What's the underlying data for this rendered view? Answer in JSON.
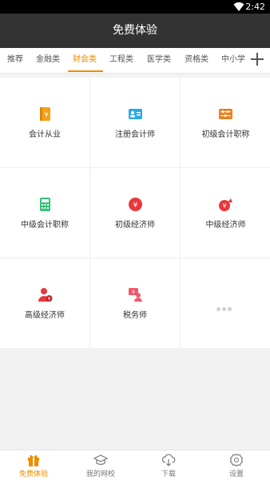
{
  "status_bar": {
    "time": "2:42"
  },
  "app_bar": {
    "title": "免费体验"
  },
  "tabs": {
    "items": [
      {
        "label": "推荐"
      },
      {
        "label": "金融类"
      },
      {
        "label": "财会类",
        "active": true
      },
      {
        "label": "工程类"
      },
      {
        "label": "医学类"
      },
      {
        "label": "资格类"
      },
      {
        "label": "中小学"
      }
    ],
    "add_icon": "plus-icon"
  },
  "grid": {
    "items": [
      {
        "label": "会计从业",
        "icon": "accounting-book-icon",
        "color": "#f5a01a"
      },
      {
        "label": "注册会计师",
        "icon": "id-card-icon",
        "color": "#2aa7f0"
      },
      {
        "label": "初级会计职称",
        "icon": "abacus-icon",
        "color": "#f07d1a"
      },
      {
        "label": "中级会计职称",
        "icon": "calculator-icon",
        "color": "#35c17a"
      },
      {
        "label": "初级经济师",
        "icon": "yen-coin-icon",
        "color": "#e8383d"
      },
      {
        "label": "中级经济师",
        "icon": "yen-growth-icon",
        "color": "#e8383d"
      },
      {
        "label": "高级经济师",
        "icon": "person-yen-icon",
        "color": "#e8383d"
      },
      {
        "label": "税务师",
        "icon": "tax-person-icon",
        "color": "#ef5a6f"
      },
      {
        "label": "",
        "icon": "more-dots-icon",
        "color": "#d0d0d0"
      }
    ]
  },
  "bottom_nav": {
    "items": [
      {
        "label": "免费体验",
        "icon": "gift-icon",
        "active": true
      },
      {
        "label": "我的网校",
        "icon": "graduation-cap-icon"
      },
      {
        "label": "下载",
        "icon": "cloud-download-icon"
      },
      {
        "label": "设置",
        "icon": "gear-icon"
      }
    ]
  },
  "colors": {
    "accent": "#f08c00",
    "app_bar": "#333333",
    "status_bar": "#000000"
  }
}
